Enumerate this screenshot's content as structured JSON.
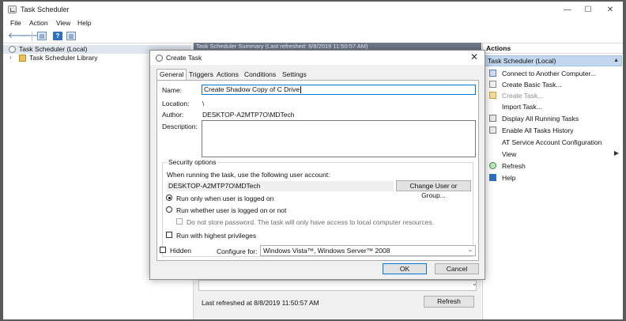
{
  "window": {
    "title": "Task Scheduler",
    "controls": {
      "minimize": "—",
      "maximize": "☐",
      "close": "✕"
    }
  },
  "menu": [
    "File",
    "Action",
    "View",
    "Help"
  ],
  "toolbar": {
    "back": "🡐",
    "forward": "🡒",
    "help": "?"
  },
  "tree": {
    "root": "Task Scheduler (Local)",
    "child": "Task Scheduler Library",
    "expander": "›"
  },
  "middle": {
    "header": "Task Scheduler Summary (Last refreshed: 8/8/2019 11:50:57 AM)",
    "scroll_down": "⌄",
    "last_refreshed": "Last refreshed at 8/8/2019 11:50:57 AM",
    "refresh_button": "Refresh"
  },
  "actions": {
    "header": "Actions",
    "section": "Task Scheduler (Local)",
    "section_arrow": "▲",
    "items": [
      {
        "label": "Connect to Another Computer...",
        "icon": "computer-icon",
        "disabled": false
      },
      {
        "label": "Create Basic Task...",
        "icon": "wizard-icon",
        "disabled": false
      },
      {
        "label": "Create Task...",
        "icon": "task-icon",
        "disabled": true
      },
      {
        "label": "Import Task...",
        "icon": "blank",
        "disabled": false
      },
      {
        "label": "Display All Running Tasks",
        "icon": "list-icon",
        "disabled": false
      },
      {
        "label": "Enable All Tasks History",
        "icon": "history-icon",
        "disabled": false
      },
      {
        "label": "AT Service Account Configuration",
        "icon": "blank",
        "disabled": false
      },
      {
        "label": "View",
        "icon": "blank",
        "disabled": false,
        "submenu": "▶"
      },
      {
        "label": "Refresh",
        "icon": "refresh-icon",
        "disabled": false
      },
      {
        "label": "Help",
        "icon": "help-icon",
        "disabled": false
      }
    ]
  },
  "dialog": {
    "title": "Create Task",
    "close": "✕",
    "tabs": [
      "General",
      "Triggers",
      "Actions",
      "Conditions",
      "Settings"
    ],
    "active_tab": "General",
    "name_label": "Name:",
    "name_value": "Create Shadow Copy of C Drive",
    "location_label": "Location:",
    "location_value": "\\",
    "author_label": "Author:",
    "author_value": "DESKTOP-A2MTP7O\\MDTech",
    "description_label": "Description:",
    "description_value": "",
    "security": {
      "title": "Security options",
      "prompt": "When running the task, use the following user account:",
      "account": "DESKTOP-A2MTP7O\\MDTech",
      "change_button": "Change User or Group...",
      "radio_logged_on": "Run only when user is logged on",
      "radio_whether": "Run whether user is logged on or not",
      "no_password": "Do not store password.  The task will only have access to local computer resources.",
      "highest": "Run with highest privileges",
      "selected": "logged_on"
    },
    "hidden_label": "Hidden",
    "configure_label": "Configure for:",
    "configure_value": "Windows Vista™, Windows Server™ 2008",
    "select_arrow": "⌄",
    "ok": "OK",
    "cancel": "Cancel"
  }
}
